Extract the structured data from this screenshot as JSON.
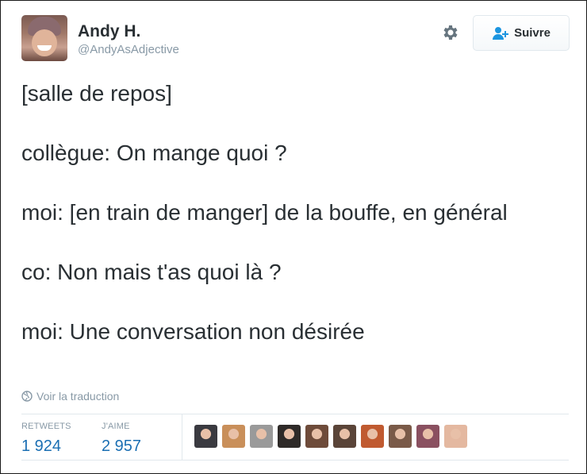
{
  "user": {
    "name": "Andy H.",
    "handle": "@AndyAsAdjective"
  },
  "follow_button": {
    "label": "Suivre"
  },
  "tweet": {
    "lines": [
      "[salle de repos]",
      "collègue: On mange quoi ?",
      "moi: [en train de manger] de la bouffe, en général",
      "co: Non mais t'as quoi là ?",
      "moi: Une conversation non désirée"
    ]
  },
  "translate_link": "Voir la traduction",
  "stats": {
    "retweets_label": "RETWEETS",
    "retweets_value": "1 924",
    "likes_label": "J'AIME",
    "likes_value": "2 957"
  },
  "icons": {
    "settings": "gear-icon",
    "follow": "user-add-icon",
    "translate": "globe-icon"
  },
  "colors": {
    "text": "#292f33",
    "muted": "#8899a6",
    "accent": "#1b6fb3",
    "border": "#e1e8ed"
  },
  "likers": [
    {
      "color": "#3a3a40"
    },
    {
      "color": "#c98f5a"
    },
    {
      "color": "#9a9a9a"
    },
    {
      "color": "#2e2a28"
    },
    {
      "color": "#6e4b3a"
    },
    {
      "color": "#5a4438"
    },
    {
      "color": "#c05a30"
    },
    {
      "color": "#7a5a48"
    },
    {
      "color": "#8a5060"
    },
    {
      "color": "#e4b8a0"
    }
  ]
}
